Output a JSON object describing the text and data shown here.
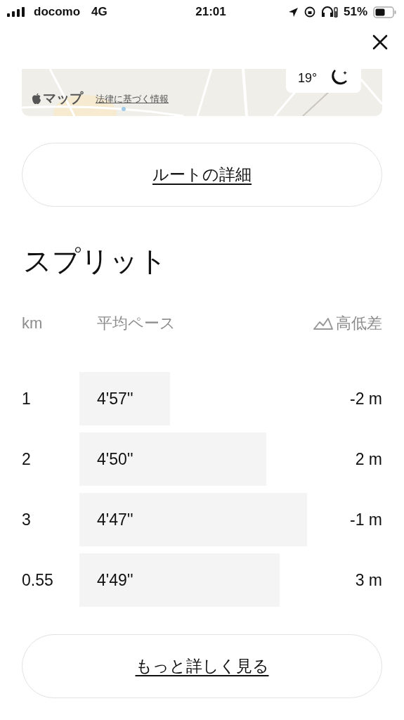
{
  "status_bar": {
    "carrier": "docomo",
    "network": "4G",
    "time": "21:01",
    "battery": "51%"
  },
  "map": {
    "kind": "picture",
    "brand": "マップ",
    "legal_link": "法律に基づく情報",
    "temperature": "19°"
  },
  "route_button": "ルートの詳細",
  "section_title": "スプリット",
  "table": {
    "columns": [
      "km",
      "平均ペース",
      "高低差"
    ],
    "rows": [
      {
        "km": "1",
        "pace": "4'57''",
        "elevation": "-2 m"
      },
      {
        "km": "2",
        "pace": "4'50''",
        "elevation": "2 m"
      },
      {
        "km": "3",
        "pace": "4'47''",
        "elevation": "-1 m"
      },
      {
        "km": "0.55",
        "pace": "4'49''",
        "elevation": "3 m"
      }
    ]
  },
  "more_button": "もっと詳しく見る"
}
